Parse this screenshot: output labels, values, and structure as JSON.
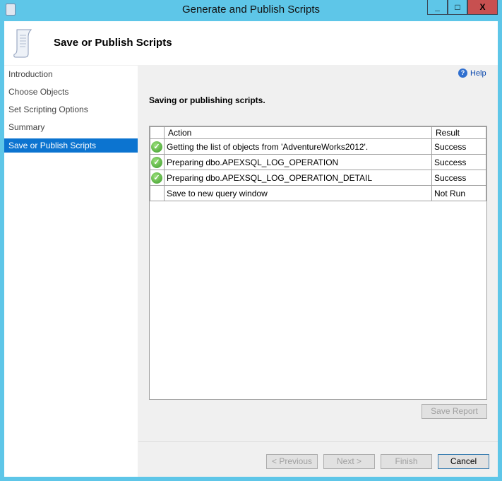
{
  "window": {
    "title": "Generate and Publish Scripts",
    "minimize": "_",
    "maximize": "□",
    "close": "X"
  },
  "header": {
    "title": "Save or Publish Scripts"
  },
  "sidebar": {
    "items": [
      {
        "label": "Introduction"
      },
      {
        "label": "Choose Objects"
      },
      {
        "label": "Set Scripting Options"
      },
      {
        "label": "Summary"
      },
      {
        "label": "Save or Publish Scripts",
        "selected": true
      }
    ]
  },
  "help": {
    "label": "Help"
  },
  "main": {
    "section_title": "Saving or publishing scripts.",
    "columns": {
      "action": "Action",
      "result": "Result"
    },
    "rows": [
      {
        "status": "success-icon",
        "action": "Getting the list of objects from 'AdventureWorks2012'.",
        "result": "Success"
      },
      {
        "status": "success-icon",
        "action": "Preparing dbo.APEXSQL_LOG_OPERATION",
        "result": "Success"
      },
      {
        "status": "success-icon",
        "action": "Preparing dbo.APEXSQL_LOG_OPERATION_DETAIL",
        "result": "Success"
      },
      {
        "status": "",
        "action": "Save to new query window",
        "result": "Not Run"
      }
    ],
    "save_report": "Save Report"
  },
  "footer": {
    "previous": "< Previous",
    "next": "Next >",
    "finish": "Finish",
    "cancel": "Cancel"
  }
}
